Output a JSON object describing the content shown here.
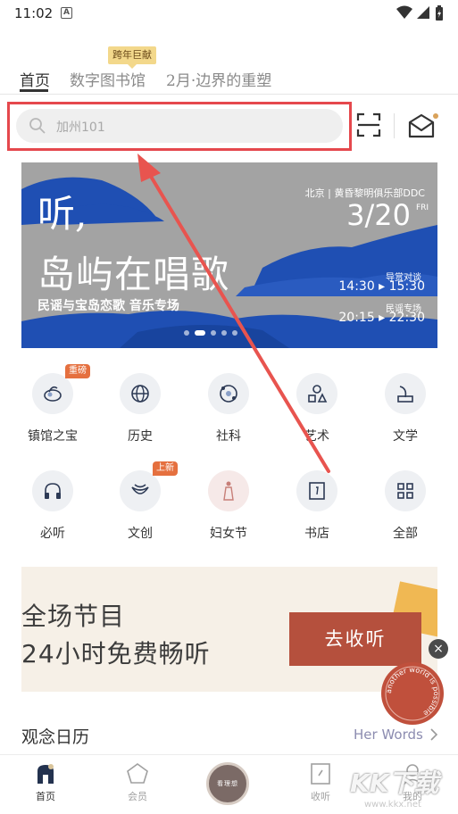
{
  "status_bar": {
    "time": "11:02",
    "notif_letter": "A"
  },
  "tabs": [
    {
      "label": "首页",
      "active": true
    },
    {
      "label": "数字图书馆",
      "active": false
    },
    {
      "label": "2月·边界的重塑",
      "active": false
    }
  ],
  "tab_badge": "跨年巨献",
  "search": {
    "placeholder": "加州101"
  },
  "banner": {
    "title_line1": "听,",
    "title_line2": "岛屿在唱歌",
    "subtitle": "民谣与宝岛恋歌 音乐专场",
    "venue": "北京 | 黄昏黎明俱乐部DDC",
    "date": "3/20",
    "day_of_week": "FRI",
    "session1_label": "导赏对谈",
    "session1_time": "14:30 ▸ 15:30",
    "session2_label": "民谣专场",
    "session2_time": "20:15 ▸ 22:30",
    "slide_count": 5,
    "active_slide": 1
  },
  "categories": [
    {
      "label": "镇馆之宝",
      "icon": "treasure-icon",
      "badge": "重磅"
    },
    {
      "label": "历史",
      "icon": "globe-icon",
      "badge": ""
    },
    {
      "label": "社科",
      "icon": "atom-icon",
      "badge": ""
    },
    {
      "label": "艺术",
      "icon": "shapes-icon",
      "badge": ""
    },
    {
      "label": "文学",
      "icon": "quill-icon",
      "badge": ""
    },
    {
      "label": "必听",
      "icon": "headphones-icon",
      "badge": ""
    },
    {
      "label": "文创",
      "icon": "creative-icon",
      "badge": "上新"
    },
    {
      "label": "妇女节",
      "icon": "woman-icon",
      "badge": ""
    },
    {
      "label": "书店",
      "icon": "book-icon",
      "badge": ""
    },
    {
      "label": "全部",
      "icon": "grid-icon",
      "badge": ""
    }
  ],
  "promo": {
    "line1": "全场节目",
    "line2": "24小时免费畅听",
    "button": "去收听"
  },
  "float_badge_text": "another world is possible",
  "section": {
    "title": "观念日历",
    "link": "Her Words"
  },
  "bottom_nav": [
    {
      "label": "首页",
      "icon": "home-icon",
      "active": true
    },
    {
      "label": "会员",
      "icon": "diamond-icon",
      "active": false
    },
    {
      "label": "看理想",
      "icon": "center-logo",
      "active": false
    },
    {
      "label": "收听",
      "icon": "listen-icon",
      "active": false
    },
    {
      "label": "我的",
      "icon": "profile-icon",
      "active": false
    }
  ],
  "watermark": {
    "text": "KK下载",
    "url": "www.kkx.net"
  },
  "colors": {
    "highlight_red": "#e5484d",
    "banner_blue": "#1f4fb3",
    "promo_button": "#b5503d",
    "badge_orange": "#e5703f"
  }
}
